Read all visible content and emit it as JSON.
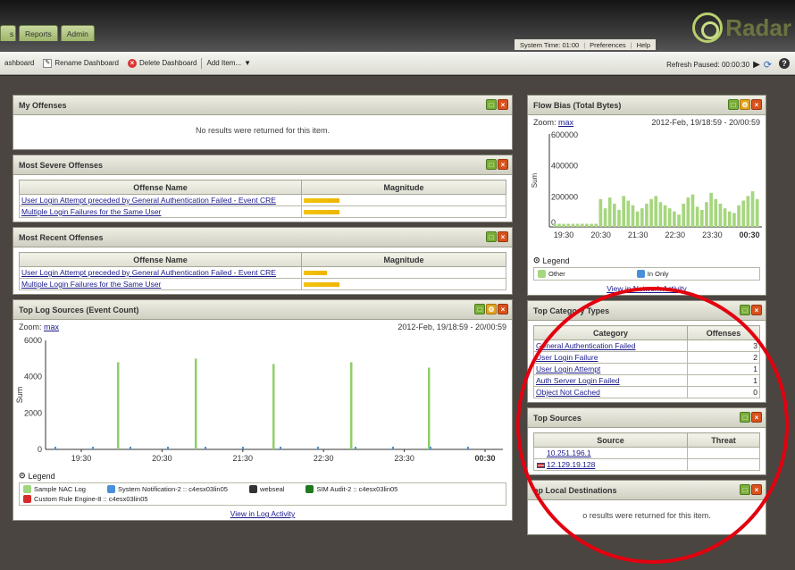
{
  "tabs": [
    "s",
    "Reports",
    "Admin"
  ],
  "system_bar": {
    "time": "System Time: 01:00",
    "preferences": "Preferences",
    "help": "Help"
  },
  "logo": "Radar",
  "toolbar": {
    "dashboard": "ashboard",
    "rename": "Rename Dashboard",
    "delete": "Delete Dashboard",
    "add_item": "Add Item...",
    "refresh": "Refresh Paused: 00:00:30"
  },
  "my_offenses": {
    "title": "My Offenses",
    "message": "No results were returned for this item."
  },
  "most_severe": {
    "title": "Most Severe Offenses",
    "headers": [
      "Offense Name",
      "Magnitude"
    ],
    "rows": [
      {
        "name": "User Login Attempt preceded by General Authentication Failed - Event CRE"
      },
      {
        "name": "Multiple Login Failures for the Same User"
      }
    ]
  },
  "most_recent": {
    "title": "Most Recent Offenses",
    "headers": [
      "Offense Name",
      "Magnitude"
    ],
    "rows": [
      {
        "name": "User Login Attempt preceded by General Authentication Failed - Event CRE"
      },
      {
        "name": "Multiple Login Failures for the Same User"
      }
    ]
  },
  "top_log_sources": {
    "title": "Top Log Sources (Event Count)",
    "zoom_label": "Zoom:",
    "zoom_value": "max",
    "range": "2012-Feb, 19/18:59 - 20/00:59",
    "legend_title": "Legend",
    "legend": [
      {
        "label": "Sample NAC Log",
        "color": "#9fd680"
      },
      {
        "label": "System Notification-2 :: c4esx03lin05",
        "color": "#4a90d9"
      },
      {
        "label": "webseal",
        "color": "#333333"
      },
      {
        "label": "SIM Audit-2 :: c4esx03lin05",
        "color": "#1f7a1f"
      },
      {
        "label": "Custom Rule Engine-8 :: c4esx03lin05",
        "color": "#d92b2b"
      }
    ],
    "view_link": "View in Log Activity"
  },
  "flow_bias": {
    "title": "Flow Bias (Total Bytes)",
    "zoom_label": "Zoom:",
    "zoom_value": "max",
    "range": "2012-Feb, 19/18:59 - 20/00:59",
    "legend_title": "Legend",
    "legend": [
      {
        "label": "Other",
        "color": "#a6d67e"
      },
      {
        "label": "In Only",
        "color": "#4a90d9"
      }
    ],
    "view_link": "View in Network Activity"
  },
  "top_category": {
    "title": "Top Category Types",
    "headers": [
      "Category",
      "Offenses"
    ],
    "rows": [
      {
        "name": "General Authentication Failed",
        "count": "3"
      },
      {
        "name": "User Login Failure",
        "count": "2"
      },
      {
        "name": "User Login Attempt",
        "count": "1"
      },
      {
        "name": "Auth Server Login Failed",
        "count": "1"
      },
      {
        "name": "Object Not Cached",
        "count": "0"
      }
    ]
  },
  "top_sources": {
    "title": "Top Sources",
    "headers": [
      "Source",
      "Threat"
    ],
    "rows": [
      {
        "ip": "10.251.196.1"
      },
      {
        "ip": "12.129.19.128"
      }
    ]
  },
  "top_local": {
    "title": "op Local Destinations",
    "message": "o results were returned for this item."
  },
  "chart_data": [
    {
      "type": "bar",
      "title": "Top Log Sources (Event Count)",
      "ylabel": "Sum",
      "ylim": [
        0,
        6000
      ],
      "yticks": [
        "6000",
        "4000",
        "2000",
        "0"
      ],
      "xticks": [
        "19:30",
        "20:30",
        "21:30",
        "22:30",
        "23:30",
        "00:30"
      ],
      "series": [
        {
          "name": "Sample NAC Log",
          "values": [
            4800,
            5000,
            4700,
            4800,
            4500
          ]
        }
      ]
    },
    {
      "type": "bar",
      "title": "Flow Bias (Total Bytes)",
      "ylabel": "Sum",
      "ylim": [
        0,
        600000
      ],
      "yticks": [
        "600000",
        "400000",
        "200000",
        "0"
      ],
      "xticks": [
        "19:30",
        "20:30",
        "21:30",
        "22:30",
        "23:30",
        "00:30"
      ],
      "series": [
        {
          "name": "Other",
          "values": [
            20000,
            20000,
            20000,
            20000,
            20000,
            20000,
            20000,
            20000,
            20000,
            20000,
            180000,
            120000,
            190000,
            150000,
            110000,
            200000,
            170000,
            140000,
            100000,
            120000,
            150000,
            180000,
            200000,
            160000,
            140000,
            120000,
            100000,
            80000,
            150000,
            190000,
            210000,
            130000,
            110000,
            160000,
            220000,
            180000,
            150000,
            120000,
            100000,
            90000,
            140000,
            170000,
            200000,
            230000,
            180000
          ]
        }
      ]
    }
  ]
}
